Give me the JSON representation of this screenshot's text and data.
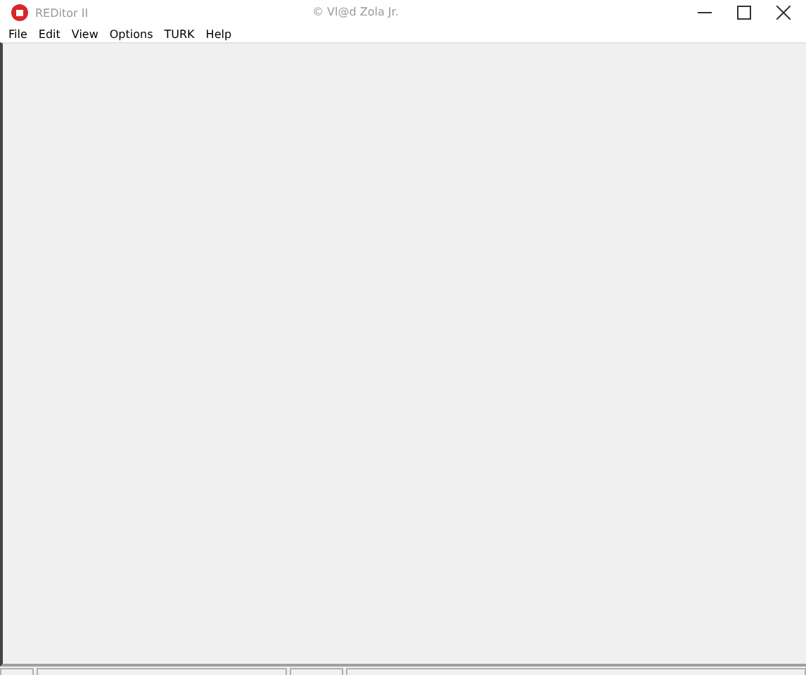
{
  "window": {
    "title": "REDitor II",
    "subtitle": "© Vl@d Zola Jr."
  },
  "menu": [
    {
      "label": "File"
    },
    {
      "label": "Edit"
    },
    {
      "label": "View"
    },
    {
      "label": "Options"
    },
    {
      "label": "TURK"
    },
    {
      "label": "Help"
    }
  ]
}
